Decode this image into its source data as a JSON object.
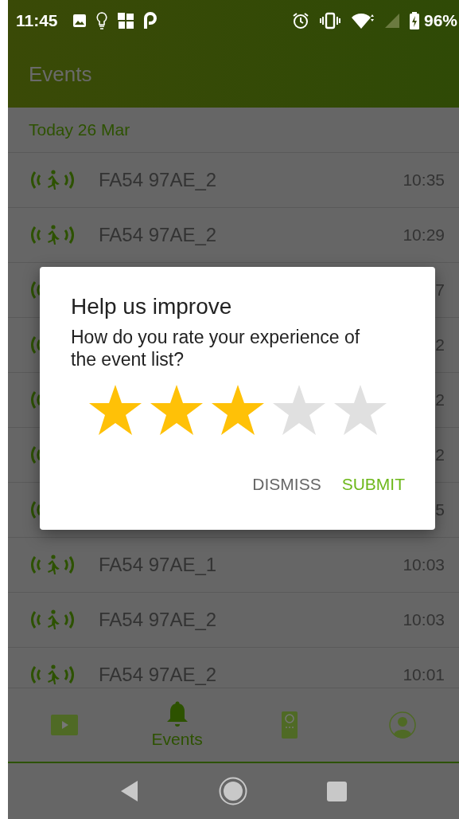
{
  "status_bar": {
    "time": "11:45",
    "battery": "96%"
  },
  "app_bar": {
    "title": "Events"
  },
  "section": {
    "title": "Today 26 Mar"
  },
  "events": [
    {
      "name": "FA54 97AE_2",
      "time": "10:35"
    },
    {
      "name": "FA54 97AE_2",
      "time": "10:29"
    },
    {
      "time": "7"
    },
    {
      "time": "2"
    },
    {
      "time": "2"
    },
    {
      "time": "2"
    },
    {
      "time": "5"
    },
    {
      "name": "FA54 97AE_1",
      "time": "10:03"
    },
    {
      "name": "FA54 97AE_2",
      "time": "10:03"
    },
    {
      "name": "FA54 97AE_2",
      "time": "10:01"
    }
  ],
  "dialog": {
    "title": "Help us improve",
    "message": "How do you rate your experience of the event list?",
    "rating": {
      "stars": 3
    },
    "buttons": [
      {
        "label": "DISMISS",
        "kind": "secondary"
      },
      {
        "label": "SUBMIT",
        "kind": "primary"
      }
    ]
  },
  "bottom_nav": [
    {
      "kind": "video",
      "selected": false
    },
    {
      "kind": "bell",
      "label": "Events",
      "selected": true
    },
    {
      "kind": "device",
      "selected": false
    },
    {
      "kind": "profile",
      "selected": false
    }
  ]
}
